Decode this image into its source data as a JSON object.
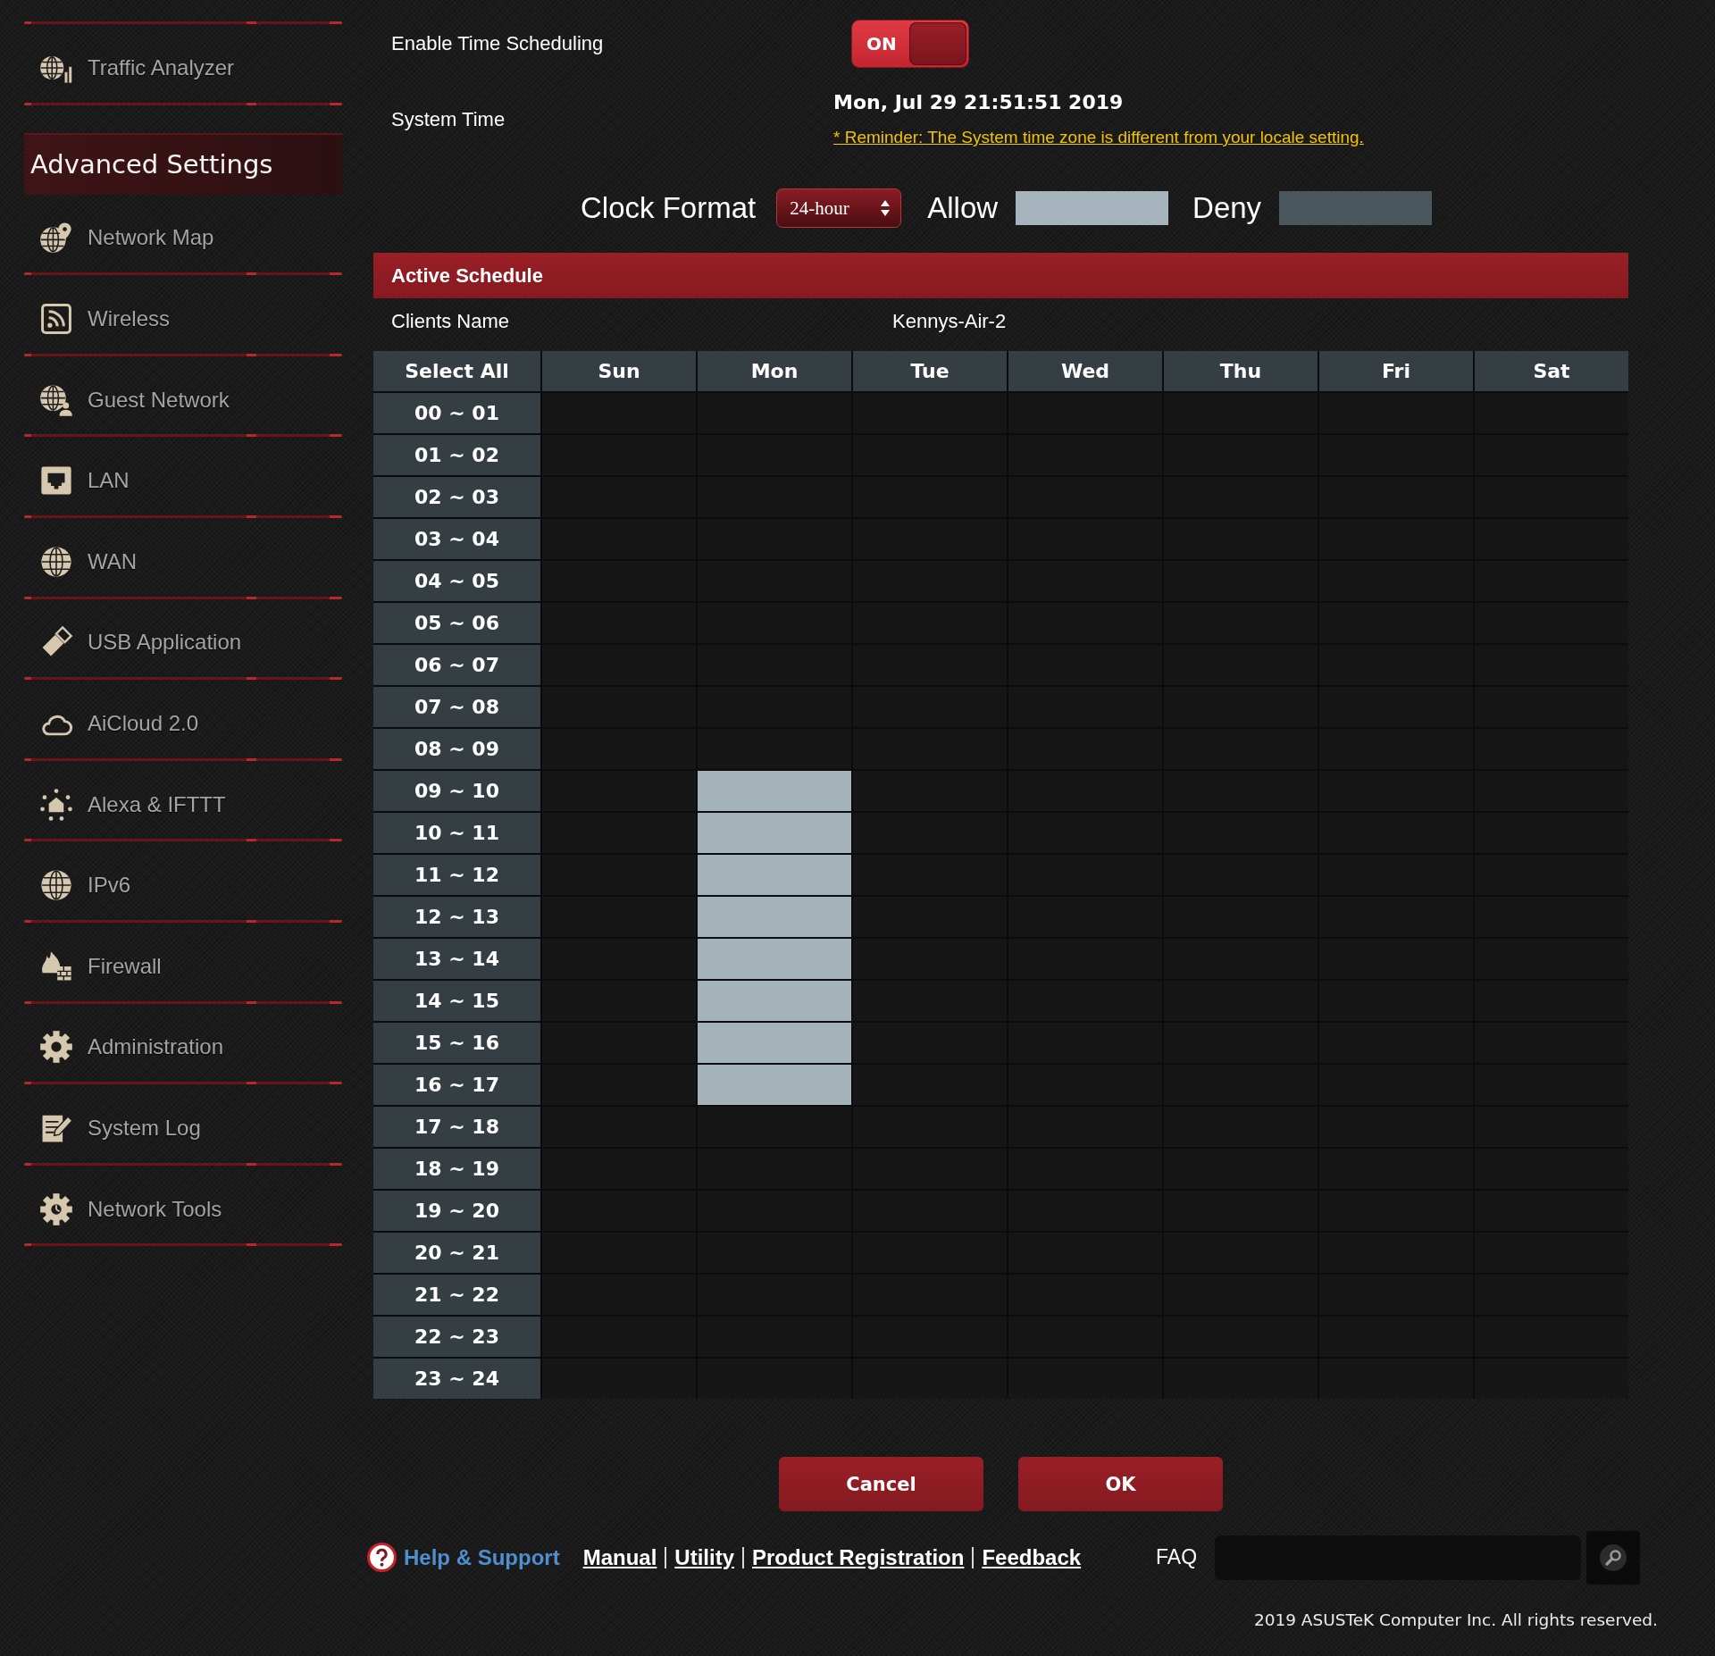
{
  "sidebar": {
    "items": [
      {
        "label": "Traffic Analyzer"
      }
    ],
    "section_title": "Advanced Settings",
    "section_items": [
      {
        "label": "Network Map"
      },
      {
        "label": "Wireless"
      },
      {
        "label": "Guest Network"
      },
      {
        "label": "LAN"
      },
      {
        "label": "WAN"
      },
      {
        "label": "USB Application"
      },
      {
        "label": "AiCloud 2.0"
      },
      {
        "label": "Alexa & IFTTT"
      },
      {
        "label": "IPv6"
      },
      {
        "label": "Firewall"
      },
      {
        "label": "Administration"
      },
      {
        "label": "System Log"
      },
      {
        "label": "Network Tools"
      }
    ]
  },
  "time_scheduling": {
    "label": "Enable Time Scheduling",
    "on": true,
    "state_label": "ON"
  },
  "system_time": {
    "label": "System Time",
    "value": "Mon, Jul 29 21:51:51 2019",
    "reminder": "* Reminder: The System time zone is different from your locale setting."
  },
  "clock_format": {
    "label": "Clock Format",
    "value": "24-hour"
  },
  "legend": [
    {
      "label": "Allow",
      "color": "#a6b5bd"
    },
    {
      "label": "Deny",
      "color": "#4a575d"
    }
  ],
  "active_schedule": {
    "title": "Active Schedule",
    "client_label": "Clients Name",
    "client_value": "Kennys-Air-2"
  },
  "table": {
    "columns": [
      "Select All",
      "Sun",
      "Mon",
      "Tue",
      "Wed",
      "Thu",
      "Fri",
      "Sat"
    ],
    "rows": [
      {
        "label": "00 ~ 01",
        "cells": [
          {
            "selected": false
          },
          {
            "selected": false
          },
          {
            "selected": false
          },
          {
            "selected": false
          },
          {
            "selected": false
          },
          {
            "selected": false
          },
          {
            "selected": false
          }
        ]
      },
      {
        "label": "01 ~ 02",
        "cells": [
          {
            "selected": false
          },
          {
            "selected": false
          },
          {
            "selected": false
          },
          {
            "selected": false
          },
          {
            "selected": false
          },
          {
            "selected": false
          },
          {
            "selected": false
          }
        ]
      },
      {
        "label": "02 ~ 03",
        "cells": [
          {
            "selected": false
          },
          {
            "selected": false
          },
          {
            "selected": false
          },
          {
            "selected": false
          },
          {
            "selected": false
          },
          {
            "selected": false
          },
          {
            "selected": false
          }
        ]
      },
      {
        "label": "03 ~ 04",
        "cells": [
          {
            "selected": false
          },
          {
            "selected": false
          },
          {
            "selected": false
          },
          {
            "selected": false
          },
          {
            "selected": false
          },
          {
            "selected": false
          },
          {
            "selected": false
          }
        ]
      },
      {
        "label": "04 ~ 05",
        "cells": [
          {
            "selected": false
          },
          {
            "selected": false
          },
          {
            "selected": false
          },
          {
            "selected": false
          },
          {
            "selected": false
          },
          {
            "selected": false
          },
          {
            "selected": false
          }
        ]
      },
      {
        "label": "05 ~ 06",
        "cells": [
          {
            "selected": false
          },
          {
            "selected": false
          },
          {
            "selected": false
          },
          {
            "selected": false
          },
          {
            "selected": false
          },
          {
            "selected": false
          },
          {
            "selected": false
          }
        ]
      },
      {
        "label": "06 ~ 07",
        "cells": [
          {
            "selected": false
          },
          {
            "selected": false
          },
          {
            "selected": false
          },
          {
            "selected": false
          },
          {
            "selected": false
          },
          {
            "selected": false
          },
          {
            "selected": false
          }
        ]
      },
      {
        "label": "07 ~ 08",
        "cells": [
          {
            "selected": false
          },
          {
            "selected": false
          },
          {
            "selected": false
          },
          {
            "selected": false
          },
          {
            "selected": false
          },
          {
            "selected": false
          },
          {
            "selected": false
          }
        ]
      },
      {
        "label": "08 ~ 09",
        "cells": [
          {
            "selected": false
          },
          {
            "selected": false
          },
          {
            "selected": false
          },
          {
            "selected": false
          },
          {
            "selected": false
          },
          {
            "selected": false
          },
          {
            "selected": false
          }
        ]
      },
      {
        "label": "09 ~ 10",
        "cells": [
          {
            "selected": false
          },
          {
            "selected": true
          },
          {
            "selected": false
          },
          {
            "selected": false
          },
          {
            "selected": false
          },
          {
            "selected": false
          },
          {
            "selected": false
          }
        ]
      },
      {
        "label": "10 ~ 11",
        "cells": [
          {
            "selected": false
          },
          {
            "selected": true
          },
          {
            "selected": false
          },
          {
            "selected": false
          },
          {
            "selected": false
          },
          {
            "selected": false
          },
          {
            "selected": false
          }
        ]
      },
      {
        "label": "11 ~ 12",
        "cells": [
          {
            "selected": false
          },
          {
            "selected": true
          },
          {
            "selected": false
          },
          {
            "selected": false
          },
          {
            "selected": false
          },
          {
            "selected": false
          },
          {
            "selected": false
          }
        ]
      },
      {
        "label": "12 ~ 13",
        "cells": [
          {
            "selected": false
          },
          {
            "selected": true
          },
          {
            "selected": false
          },
          {
            "selected": false
          },
          {
            "selected": false
          },
          {
            "selected": false
          },
          {
            "selected": false
          }
        ]
      },
      {
        "label": "13 ~ 14",
        "cells": [
          {
            "selected": false
          },
          {
            "selected": true
          },
          {
            "selected": false
          },
          {
            "selected": false
          },
          {
            "selected": false
          },
          {
            "selected": false
          },
          {
            "selected": false
          }
        ]
      },
      {
        "label": "14 ~ 15",
        "cells": [
          {
            "selected": false
          },
          {
            "selected": true
          },
          {
            "selected": false
          },
          {
            "selected": false
          },
          {
            "selected": false
          },
          {
            "selected": false
          },
          {
            "selected": false
          }
        ]
      },
      {
        "label": "15 ~ 16",
        "cells": [
          {
            "selected": false
          },
          {
            "selected": true
          },
          {
            "selected": false
          },
          {
            "selected": false
          },
          {
            "selected": false
          },
          {
            "selected": false
          },
          {
            "selected": false
          }
        ]
      },
      {
        "label": "16 ~ 17",
        "cells": [
          {
            "selected": false
          },
          {
            "selected": true
          },
          {
            "selected": false
          },
          {
            "selected": false
          },
          {
            "selected": false
          },
          {
            "selected": false
          },
          {
            "selected": false
          }
        ]
      },
      {
        "label": "17 ~ 18",
        "cells": [
          {
            "selected": false
          },
          {
            "selected": false
          },
          {
            "selected": false
          },
          {
            "selected": false
          },
          {
            "selected": false
          },
          {
            "selected": false
          },
          {
            "selected": false
          }
        ]
      },
      {
        "label": "18 ~ 19",
        "cells": [
          {
            "selected": false
          },
          {
            "selected": false
          },
          {
            "selected": false
          },
          {
            "selected": false
          },
          {
            "selected": false
          },
          {
            "selected": false
          },
          {
            "selected": false
          }
        ]
      },
      {
        "label": "19 ~ 20",
        "cells": [
          {
            "selected": false
          },
          {
            "selected": false
          },
          {
            "selected": false
          },
          {
            "selected": false
          },
          {
            "selected": false
          },
          {
            "selected": false
          },
          {
            "selected": false
          }
        ]
      },
      {
        "label": "20 ~ 21",
        "cells": [
          {
            "selected": false
          },
          {
            "selected": false
          },
          {
            "selected": false
          },
          {
            "selected": false
          },
          {
            "selected": false
          },
          {
            "selected": false
          },
          {
            "selected": false
          }
        ]
      },
      {
        "label": "21 ~ 22",
        "cells": [
          {
            "selected": false
          },
          {
            "selected": false
          },
          {
            "selected": false
          },
          {
            "selected": false
          },
          {
            "selected": false
          },
          {
            "selected": false
          },
          {
            "selected": false
          }
        ]
      },
      {
        "label": "22 ~ 23",
        "cells": [
          {
            "selected": false
          },
          {
            "selected": false
          },
          {
            "selected": false
          },
          {
            "selected": false
          },
          {
            "selected": false
          },
          {
            "selected": false
          },
          {
            "selected": false
          }
        ]
      },
      {
        "label": "23 ~ 24",
        "cells": [
          {
            "selected": false
          },
          {
            "selected": false
          },
          {
            "selected": false
          },
          {
            "selected": false
          },
          {
            "selected": false
          },
          {
            "selected": false
          },
          {
            "selected": false
          }
        ]
      }
    ]
  },
  "buttons": [
    "Cancel",
    "OK"
  ],
  "footer": {
    "help": "Help & Support",
    "links": [
      "Manual",
      "Utility",
      "Product Registration",
      "Feedback"
    ],
    "faq_label": "FAQ",
    "copyright": "2019 ASUSTeK Computer Inc. All rights reserved."
  }
}
